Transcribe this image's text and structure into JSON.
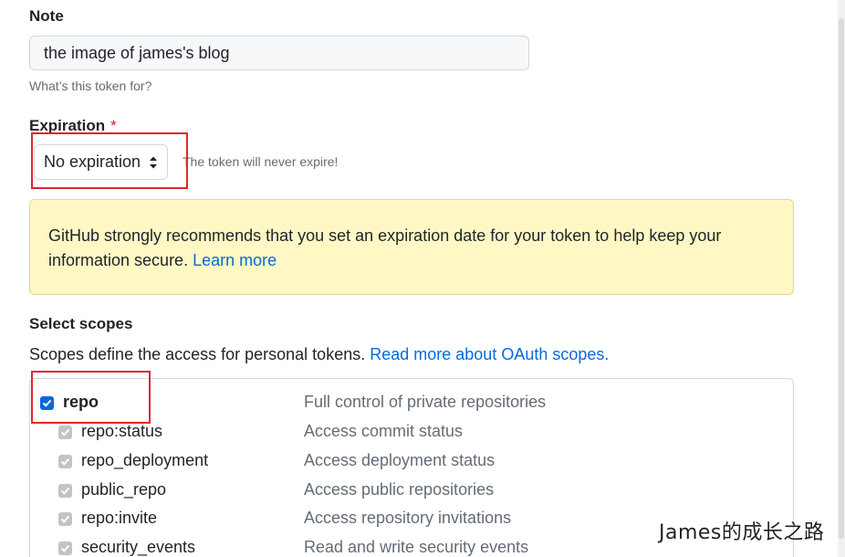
{
  "note": {
    "label": "Note",
    "value": "the image of james's blog",
    "help": "What’s this token for?"
  },
  "expiration": {
    "label": "Expiration",
    "required_mark": "*",
    "selected": "No expiration",
    "help": "The token will never expire!"
  },
  "warning": {
    "text": "GitHub strongly recommends that you set an expiration date for your token to help keep your information secure.",
    "link": "Learn more",
    "bg_color": "#fff8c5"
  },
  "scopes": {
    "title": "Select scopes",
    "description": "Scopes define the access for personal tokens.",
    "link": "Read more about OAuth scopes.",
    "items": [
      {
        "name": "repo",
        "description": "Full control of private repositories",
        "checked": true,
        "parent": true
      },
      {
        "name": "repo:status",
        "description": "Access commit status",
        "checked": true,
        "parent": false
      },
      {
        "name": "repo_deployment",
        "description": "Access deployment status",
        "checked": true,
        "parent": false
      },
      {
        "name": "public_repo",
        "description": "Access public repositories",
        "checked": true,
        "parent": false
      },
      {
        "name": "repo:invite",
        "description": "Access repository invitations",
        "checked": true,
        "parent": false
      },
      {
        "name": "security_events",
        "description": "Read and write security events",
        "checked": true,
        "parent": false
      }
    ]
  },
  "watermark": "James的成长之路",
  "colors": {
    "link": "#0969da",
    "highlight_box": "#e0262c",
    "required": "#cf222e"
  }
}
